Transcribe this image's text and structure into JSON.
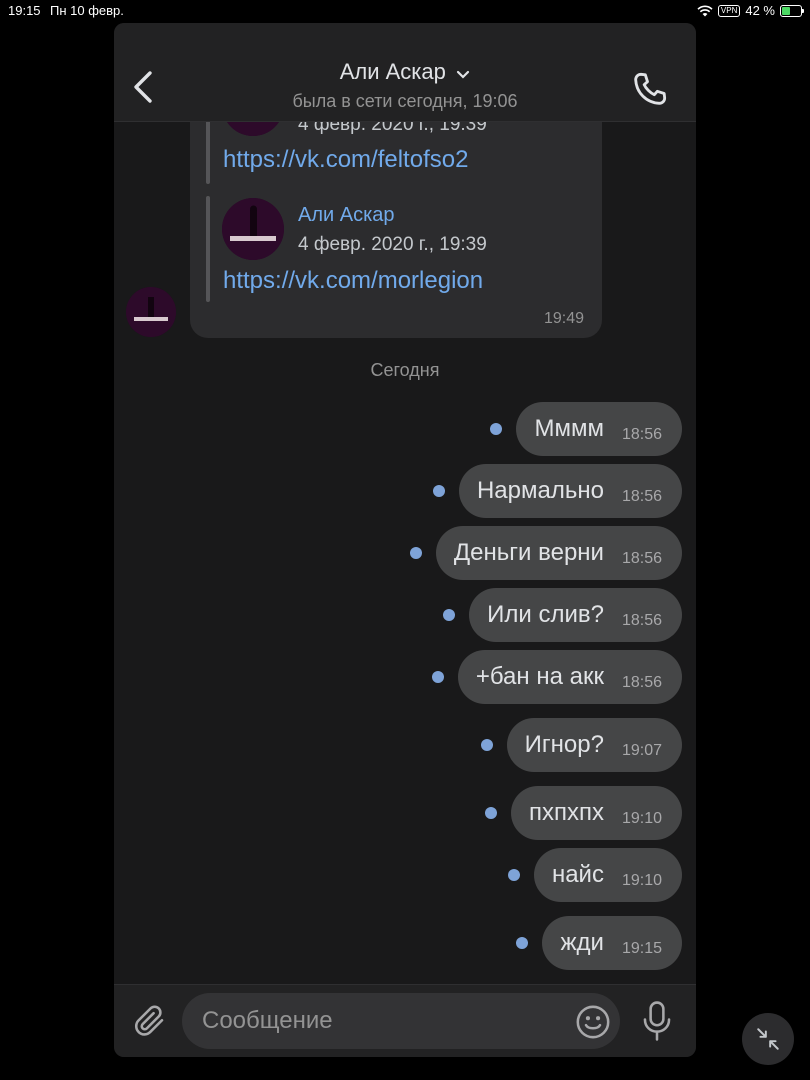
{
  "status_bar": {
    "time": "19:15",
    "date": "Пн 10 февр.",
    "vpn": "VPN",
    "battery": "42 %",
    "battery_level": 0.42
  },
  "header": {
    "title": "Али Аскар",
    "status": "была в сети сегодня, 19:06"
  },
  "forwarded_message": {
    "items": [
      {
        "date": "4 февр. 2020 г., 19:39",
        "link": "https://vk.com/feltofso2"
      },
      {
        "name": "Али Аскар",
        "date": "4 февр. 2020 г., 19:39",
        "link": "https://vk.com/morlegion"
      }
    ],
    "time": "19:49"
  },
  "day_separator": "Сегодня",
  "outgoing_messages": [
    {
      "text": "Мммм",
      "time": "18:56"
    },
    {
      "text": "Нармально",
      "time": "18:56"
    },
    {
      "text": "Деньги верни",
      "time": "18:56"
    },
    {
      "text": "Или слив?",
      "time": "18:56"
    },
    {
      "text": "+бан на акк",
      "time": "18:56"
    },
    {
      "text": "Игнор?",
      "time": "19:07"
    },
    {
      "text": "пхпхпх",
      "time": "19:10"
    },
    {
      "text": "найс",
      "time": "19:10"
    },
    {
      "text": "жди",
      "time": "19:15"
    }
  ],
  "composer": {
    "placeholder": "Сообщение"
  },
  "icons": {
    "back": "chevron-left-icon",
    "dropdown": "chevron-down-icon",
    "call": "phone-icon",
    "attach": "paperclip-icon",
    "emoji": "smiley-icon",
    "mic": "microphone-icon",
    "minimize": "minimize-arrows-icon"
  },
  "colors": {
    "link": "#71aaeb",
    "unread_dot": "#7ea3d8",
    "bubble_out": "#454647",
    "bubble_in": "#2c2c2e",
    "background": "#19191a"
  }
}
